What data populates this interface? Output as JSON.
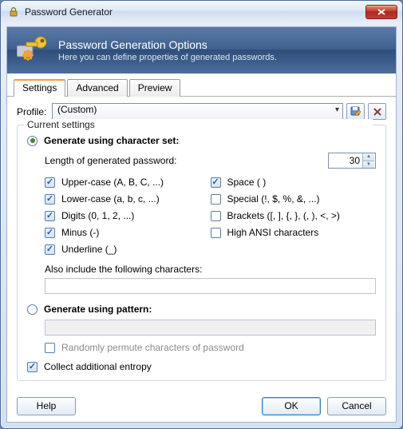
{
  "title": "Password Generator",
  "banner": {
    "title": "Password Generation Options",
    "subtitle": "Here you can define properties of generated passwords."
  },
  "tabs": [
    "Settings",
    "Advanced",
    "Preview"
  ],
  "profile": {
    "label": "Profile:",
    "value": "(Custom)"
  },
  "group": {
    "legend": "Current settings"
  },
  "charset": {
    "radio_label": "Generate using character set:",
    "length_label": "Length of generated password:",
    "length_value": "30",
    "options": [
      {
        "label": "Upper-case (A, B, C, ...)",
        "checked": true
      },
      {
        "label": "Lower-case (a, b, c, ...)",
        "checked": true
      },
      {
        "label": "Digits (0, 1, 2, ...)",
        "checked": true
      },
      {
        "label": "Minus (-)",
        "checked": true
      },
      {
        "label": "Underline (_)",
        "checked": true
      },
      {
        "label": "Space ( )",
        "checked": true
      },
      {
        "label": "Special (!, $, %, &, ...)",
        "checked": false
      },
      {
        "label": "Brackets ([, ], {, }, (, ), <, >)",
        "checked": false
      },
      {
        "label": "High ANSI characters",
        "checked": false
      }
    ],
    "also_label": "Also include the following characters:"
  },
  "pattern": {
    "radio_label": "Generate using pattern:",
    "permute_label": "Randomly permute characters of password"
  },
  "entropy_label": "Collect additional entropy",
  "buttons": {
    "help": "Help",
    "ok": "OK",
    "cancel": "Cancel"
  }
}
